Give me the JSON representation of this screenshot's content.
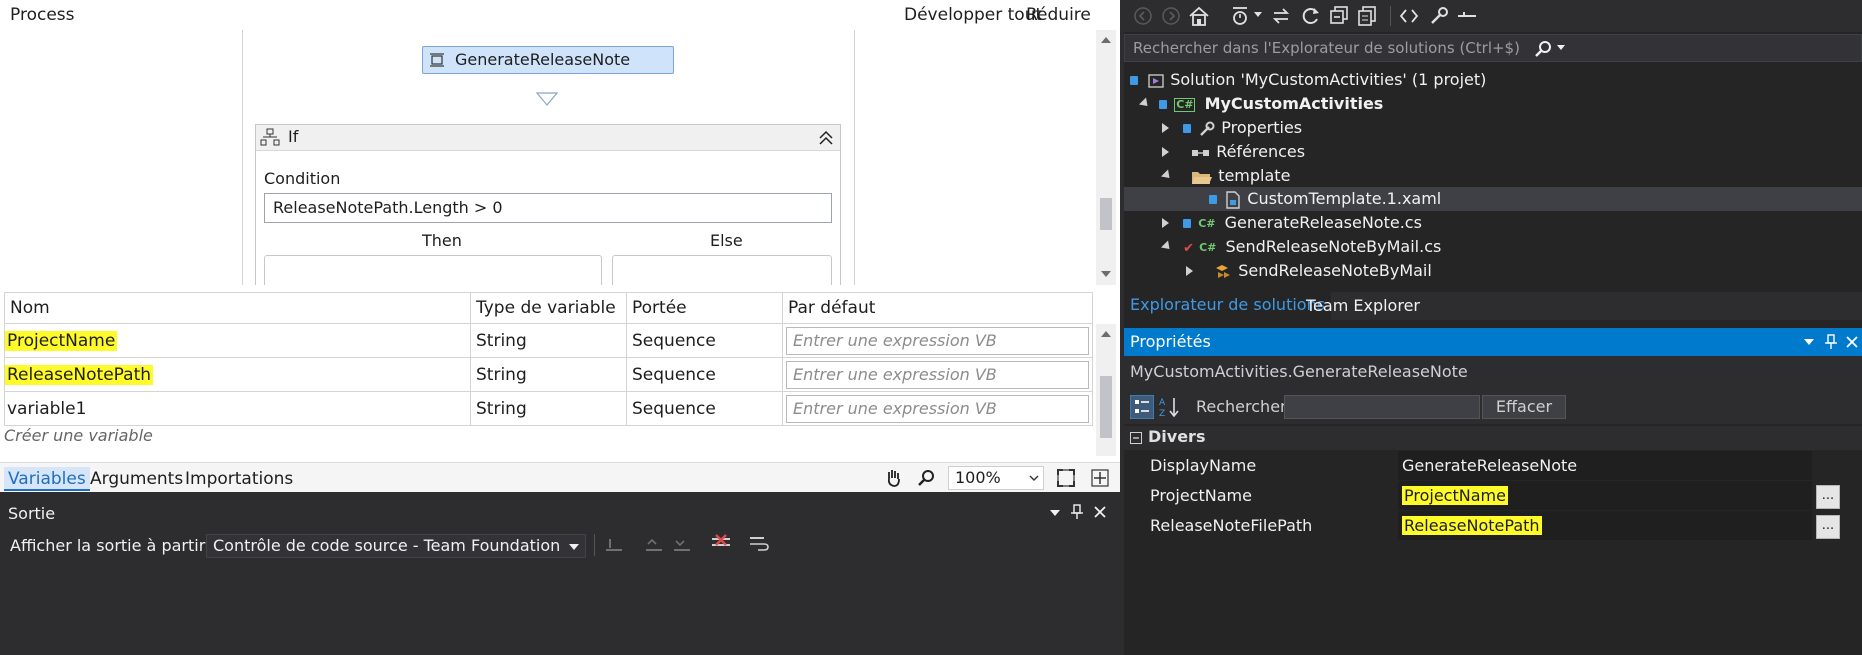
{
  "designer": {
    "breadcrumb": "Process",
    "expand_all": "Développer tout",
    "collapse_all": "Réduire tout",
    "activity_name": "GenerateReleaseNote",
    "if_title": "If",
    "condition_label": "Condition",
    "condition_value": "ReleaseNotePath.Length > 0",
    "then_label": "Then",
    "else_label": "Else"
  },
  "variables": {
    "columns": [
      "Nom",
      "Type de variable",
      "Portée",
      "Par défaut"
    ],
    "rows": [
      {
        "name": "ProjectName",
        "type": "String",
        "scope": "Sequence",
        "default_placeholder": "Entrer une expression VB"
      },
      {
        "name": "ReleaseNotePath",
        "type": "String",
        "scope": "Sequence",
        "default_placeholder": "Entrer une expression VB"
      },
      {
        "name": "variable1",
        "type": "String",
        "scope": "Sequence",
        "default_placeholder": "Entrer une expression VB"
      }
    ],
    "create_placeholder": "Créer une variable"
  },
  "designer_bar": {
    "tabs": [
      "Variables",
      "Arguments",
      "Importations"
    ],
    "active_tab": "Variables",
    "zoom": "100%"
  },
  "output": {
    "title": "Sortie",
    "show_from_label": "Afficher la sortie à partir de :",
    "source_value": "Contrôle de code source - Team Foundation"
  },
  "solution_explorer": {
    "search_placeholder": "Rechercher dans l'Explorateur de solutions (Ctrl+$)",
    "solution": "Solution 'MyCustomActivities' (1 projet)",
    "project": "MyCustomActivities",
    "properties": "Properties",
    "references": "Références",
    "template_folder": "template",
    "template_file": "CustomTemplate.1.xaml",
    "file1": "GenerateReleaseNote.cs",
    "file2": "SendReleaseNoteByMail.cs",
    "class2": "SendReleaseNoteByMail",
    "tab_active": "Explorateur de solutions",
    "tab_other": "Team Explorer"
  },
  "properties": {
    "title": "Propriétés",
    "object": "MyCustomActivities.GenerateReleaseNote",
    "search_label": "Rechercher :",
    "clear_button": "Effacer",
    "category": "Divers",
    "rows": [
      {
        "name": "DisplayName",
        "value": "GenerateReleaseNote"
      },
      {
        "name": "ProjectName",
        "value": "ProjectName"
      },
      {
        "name": "ReleaseNoteFilePath",
        "value": "ReleaseNotePath"
      }
    ],
    "ellipsis": "..."
  },
  "colors": {
    "accent": "#3f9ae6",
    "highlight": "#fffb2a",
    "dark_bg": "#252526",
    "activity_bg": "#cfe4fb"
  }
}
